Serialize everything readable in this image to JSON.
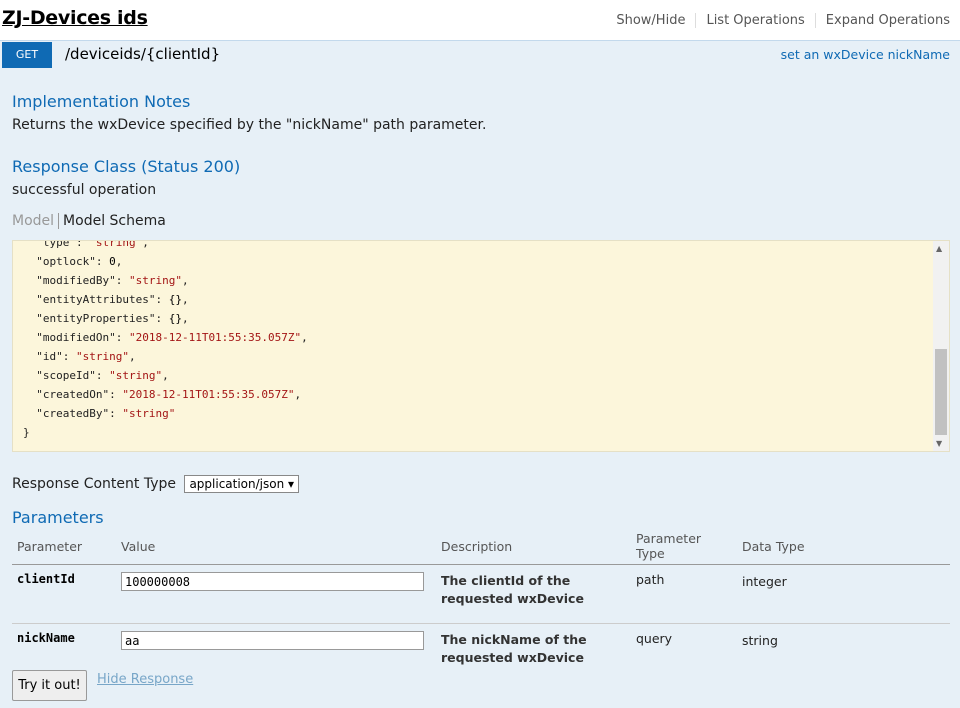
{
  "resource": {
    "title": "ZJ-Devices ids",
    "links": [
      "Show/Hide",
      "List Operations",
      "Expand Operations"
    ]
  },
  "operation": {
    "method": "GET",
    "path": "/deviceids/{clientId}",
    "summary": "set an wxDevice nickName",
    "impl_title": "Implementation Notes",
    "impl_text": "Returns the wxDevice specified by the \"nickName\" path parameter.",
    "response_class_title": "Response Class (Status 200)",
    "response_class_text": "successful operation",
    "tab_model": "Model",
    "tab_schema": "Model Schema",
    "schema_lines": [
      [
        "\"type\"",
        "\"string\"",
        ","
      ],
      [
        "\"optlock\"",
        "0",
        ","
      ],
      [
        "\"modifiedBy\"",
        "\"string\"",
        ","
      ],
      [
        "\"entityAttributes\"",
        "{}",
        ","
      ],
      [
        "\"entityProperties\"",
        "{}",
        ","
      ],
      [
        "\"modifiedOn\"",
        "\"2018-12-11T01:55:35.057Z\"",
        ","
      ],
      [
        "\"id\"",
        "\"string\"",
        ","
      ],
      [
        "\"scopeId\"",
        "\"string\"",
        ","
      ],
      [
        "\"createdOn\"",
        "\"2018-12-11T01:55:35.057Z\"",
        ","
      ],
      [
        "\"createdBy\"",
        "\"string\"",
        ""
      ]
    ],
    "schema_close": "}",
    "response_content_type_label": "Response Content Type",
    "response_content_type_value": "application/json ▾",
    "params_title": "Parameters",
    "param_headers": [
      "Parameter",
      "Value",
      "Description",
      "Parameter Type",
      "Data Type"
    ],
    "params": [
      {
        "name": "clientId",
        "value": "100000008",
        "description": "The clientId of the requested wxDevice",
        "param_type": "path",
        "data_type": "integer"
      },
      {
        "name": "nickName",
        "value": "aa",
        "description": "The nickName of the requested wxDevice",
        "param_type": "query",
        "data_type": "string"
      }
    ],
    "try_button": "Try it out!",
    "hide_response": "Hide Response"
  }
}
